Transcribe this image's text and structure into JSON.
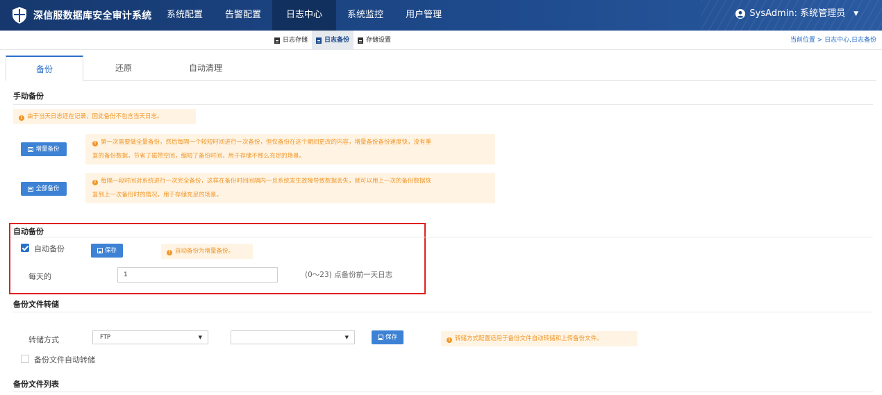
{
  "app": {
    "title": "深信服数据库安全审计系统",
    "nav": [
      "系统配置",
      "告警配置",
      "日志中心",
      "系统监控",
      "用户管理"
    ],
    "user": "SysAdmin: 系统管理员"
  },
  "subnav": {
    "items": [
      "日志存储",
      "日志备份",
      "存储设置"
    ],
    "breadcrumb": "当前位置 > 日志中心,日志备份"
  },
  "tabs": [
    "备份",
    "还原",
    "自动清理"
  ],
  "manual": {
    "title": "手动备份",
    "notice": "由于当天日志还在记录，因此备份不包含当天日志。",
    "incremental_button": "增量备份",
    "incremental_desc_1": "第一次需要做全量备份，然后每隔一个较短时间进行一次备份，但仅备份在这个期间更改的内容，增量备份备份速度快，没有重",
    "incremental_desc_2": "复的备份数据，节省了磁带空间，缩短了备份时间，用于存储不那么充足的场景。",
    "full_button": "全部备份",
    "full_desc_1": "每隔一段时间对系统进行一次完全备份，这样在备份时间间隔内一旦系统发生故障导致数据丢失，就可以用上一次的备份数据恢",
    "full_desc_2": "复到上一次备份时的情况，用于存储充足的场景。"
  },
  "auto": {
    "title": "自动备份",
    "checkbox_label": "自动备份",
    "checked": true,
    "save_button": "保存",
    "notice": "自动备份为增量备份。",
    "daily_label": "每天的",
    "hour_value": "1",
    "hour_hint": "(0～23) 点备份前一天日志"
  },
  "transfer": {
    "title": "备份文件转储",
    "method_label": "转储方式",
    "method_value": "FTP",
    "second_value": "",
    "save_button": "保存",
    "notice": "转储方式配置适用于备份文件自动转储和上传备份文件。",
    "auto_label": "备份文件自动转储",
    "auto_checked": false
  },
  "list": {
    "title": "备份文件列表"
  }
}
